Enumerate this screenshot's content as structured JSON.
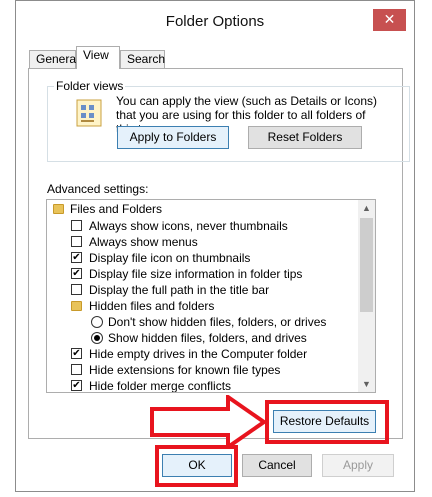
{
  "window": {
    "title": "Folder Options",
    "close_glyph": "✕"
  },
  "tabs": [
    {
      "label": "General"
    },
    {
      "label": "View"
    },
    {
      "label": "Search"
    }
  ],
  "folder_views": {
    "group_label": "Folder views",
    "icon": "folder-views-icon",
    "description": "You can apply the view (such as Details or Icons) that you are using for this folder to all folders of this type.",
    "apply_button": "Apply to Folders",
    "reset_button": "Reset Folders"
  },
  "advanced": {
    "label": "Advanced settings:",
    "items": [
      {
        "type": "folder",
        "label": "Files and Folders"
      },
      {
        "type": "checkbox",
        "checked": false,
        "label": "Always show icons, never thumbnails"
      },
      {
        "type": "checkbox",
        "checked": false,
        "label": "Always show menus"
      },
      {
        "type": "checkbox",
        "checked": true,
        "label": "Display file icon on thumbnails"
      },
      {
        "type": "checkbox",
        "checked": true,
        "label": "Display file size information in folder tips"
      },
      {
        "type": "checkbox",
        "checked": false,
        "label": "Display the full path in the title bar"
      },
      {
        "type": "folder",
        "label": "Hidden files and folders"
      },
      {
        "type": "radio",
        "checked": false,
        "label": "Don't show hidden files, folders, or drives"
      },
      {
        "type": "radio",
        "checked": true,
        "label": "Show hidden files, folders, and drives"
      },
      {
        "type": "checkbox",
        "checked": true,
        "label": "Hide empty drives in the Computer folder"
      },
      {
        "type": "checkbox",
        "checked": false,
        "label": "Hide extensions for known file types"
      },
      {
        "type": "checkbox",
        "checked": true,
        "label": "Hide folder merge conflicts"
      }
    ],
    "check_glyph": "✔"
  },
  "buttons": {
    "restore_defaults": "Restore Defaults",
    "ok": "OK",
    "cancel": "Cancel",
    "apply": "Apply"
  },
  "annotations": {
    "highlight_color": "#e8141e"
  }
}
